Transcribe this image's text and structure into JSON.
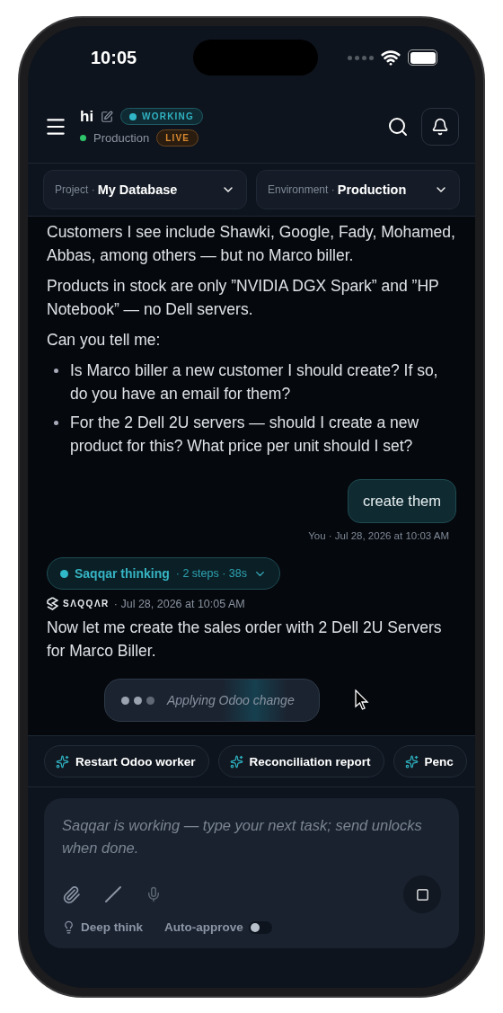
{
  "status_bar": {
    "time": "10:05"
  },
  "header": {
    "title": "hi",
    "status_badge": "WORKING",
    "environment": "Production",
    "live_badge": "LIVE"
  },
  "selectors": [
    {
      "label": "Project",
      "separator": "·",
      "value": "My Database"
    },
    {
      "label": "Environment",
      "separator": "·",
      "value": "Production"
    }
  ],
  "conversation": {
    "assistant_blocks": [
      {
        "kind": "paragraph",
        "text": "Customers I see include Shawki, Google, Fady, Mohamed, Abbas, among others — but no Marco biller."
      },
      {
        "kind": "paragraph",
        "text": "Products in stock are only ”NVIDIA DGX Spark” and ”HP Notebook” — no Dell servers."
      },
      {
        "kind": "paragraph",
        "text": "Can you tell me:"
      },
      {
        "kind": "bullets",
        "items": [
          "Is Marco biller a new customer I should create? If so, do you have an email for them?",
          "For the 2 Dell 2U servers — should I create a new product for this? What price per unit should I set?"
        ]
      }
    ],
    "user_message": {
      "text": "create them",
      "meta": "You · Jul 28, 2026 at 10:03 AM"
    },
    "thinking": {
      "label": "Saqqar thinking",
      "detail": "· 2 steps · 38s",
      "expanded": false
    },
    "assistant_reply": {
      "brand": "SΛQQΛR",
      "meta": "· Jul 28, 2026 at 10:05 AM",
      "text": "Now let me create the sales order with 2 Dell 2U Servers for Marco Biller."
    },
    "activity": {
      "text": "Applying Odoo change"
    }
  },
  "suggestions": [
    "Restart Odoo worker",
    "Reconciliation report",
    "Penc"
  ],
  "composer": {
    "placeholder": "Saqqar is working — type your next task; send unlocks when done.",
    "deep_think": "Deep think",
    "auto_approve": {
      "label": "Auto-approve",
      "on": false
    }
  }
}
